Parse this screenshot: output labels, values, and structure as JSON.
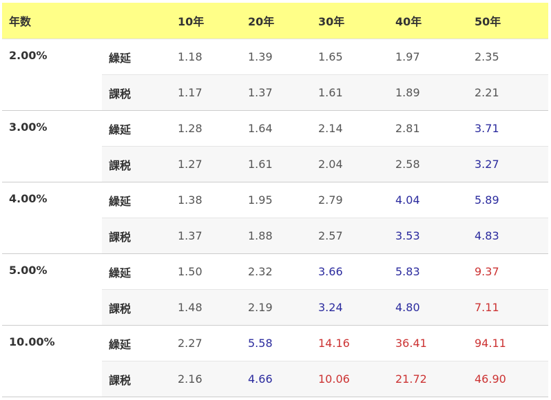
{
  "table": {
    "header": {
      "label": "年数",
      "years": [
        "10年",
        "20年",
        "30年",
        "40年",
        "50年"
      ]
    },
    "colors": {
      "header_bg": "#ffff88",
      "normal": "#555555",
      "blue": "#2b2b9e",
      "red": "#cc3333"
    },
    "groups": [
      {
        "rate": "2.00%",
        "rows": [
          {
            "kind": "繰延",
            "values": [
              "1.18",
              "1.39",
              "1.65",
              "1.97",
              "2.35"
            ],
            "tiers": [
              "normal",
              "normal",
              "normal",
              "normal",
              "normal"
            ]
          },
          {
            "kind": "課税",
            "values": [
              "1.17",
              "1.37",
              "1.61",
              "1.89",
              "2.21"
            ],
            "tiers": [
              "normal",
              "normal",
              "normal",
              "normal",
              "normal"
            ]
          }
        ]
      },
      {
        "rate": "3.00%",
        "rows": [
          {
            "kind": "繰延",
            "values": [
              "1.28",
              "1.64",
              "2.14",
              "2.81",
              "3.71"
            ],
            "tiers": [
              "normal",
              "normal",
              "normal",
              "normal",
              "blue"
            ]
          },
          {
            "kind": "課税",
            "values": [
              "1.27",
              "1.61",
              "2.04",
              "2.58",
              "3.27"
            ],
            "tiers": [
              "normal",
              "normal",
              "normal",
              "normal",
              "blue"
            ]
          }
        ]
      },
      {
        "rate": "4.00%",
        "rows": [
          {
            "kind": "繰延",
            "values": [
              "1.38",
              "1.95",
              "2.79",
              "4.04",
              "5.89"
            ],
            "tiers": [
              "normal",
              "normal",
              "normal",
              "blue",
              "blue"
            ]
          },
          {
            "kind": "課税",
            "values": [
              "1.37",
              "1.88",
              "2.57",
              "3.53",
              "4.83"
            ],
            "tiers": [
              "normal",
              "normal",
              "normal",
              "blue",
              "blue"
            ]
          }
        ]
      },
      {
        "rate": "5.00%",
        "rows": [
          {
            "kind": "繰延",
            "values": [
              "1.50",
              "2.32",
              "3.66",
              "5.83",
              "9.37"
            ],
            "tiers": [
              "normal",
              "normal",
              "blue",
              "blue",
              "red"
            ]
          },
          {
            "kind": "課税",
            "values": [
              "1.48",
              "2.19",
              "3.24",
              "4.80",
              "7.11"
            ],
            "tiers": [
              "normal",
              "normal",
              "blue",
              "blue",
              "red"
            ]
          }
        ]
      },
      {
        "rate": "10.00%",
        "rows": [
          {
            "kind": "繰延",
            "values": [
              "2.27",
              "5.58",
              "14.16",
              "36.41",
              "94.11"
            ],
            "tiers": [
              "normal",
              "blue",
              "red",
              "red",
              "red"
            ]
          },
          {
            "kind": "課税",
            "values": [
              "2.16",
              "4.66",
              "10.06",
              "21.72",
              "46.90"
            ],
            "tiers": [
              "normal",
              "blue",
              "red",
              "red",
              "red"
            ]
          }
        ]
      }
    ]
  }
}
